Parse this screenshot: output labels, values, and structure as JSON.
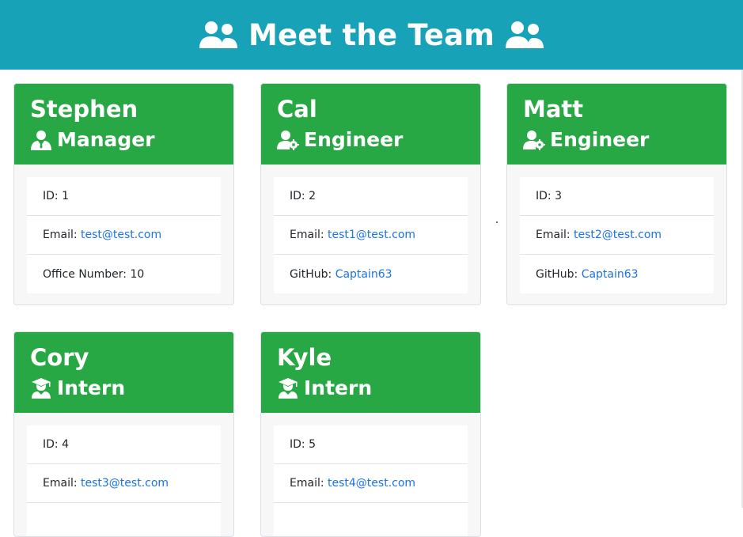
{
  "header": {
    "title": "Meet the Team",
    "left_icon": "users-icon",
    "right_icon": "users-icon",
    "background": "#17a2b8"
  },
  "cards": [
    {
      "name": "Stephen",
      "role": "Manager",
      "role_icon": "user-tie-icon",
      "id_label": "ID: 1",
      "email_label": "Email: ",
      "email": "test@test.com",
      "extra_label": "Office Number: 10",
      "extra_link": ""
    },
    {
      "name": "Cal",
      "role": "Engineer",
      "role_icon": "user-cog-icon",
      "id_label": "ID: 2",
      "email_label": "Email: ",
      "email": "test1@test.com",
      "extra_label": "GitHub: ",
      "extra_link": "Captain63"
    },
    {
      "name": "Matt",
      "role": "Engineer",
      "role_icon": "user-cog-icon",
      "id_label": "ID: 3",
      "email_label": "Email: ",
      "email": "test2@test.com",
      "extra_label": "GitHub: ",
      "extra_link": "Captain63"
    },
    {
      "name": "Cory",
      "role": "Intern",
      "role_icon": "user-graduate-icon",
      "id_label": "ID: 4",
      "email_label": "Email: ",
      "email": "test3@test.com"
    },
    {
      "name": "Kyle",
      "role": "Intern",
      "role_icon": "user-graduate-icon",
      "id_label": "ID: 5",
      "email_label": "Email: ",
      "email": "test4@test.com"
    }
  ],
  "colors": {
    "card_header": "#28a745",
    "link": "#1a73e8"
  }
}
